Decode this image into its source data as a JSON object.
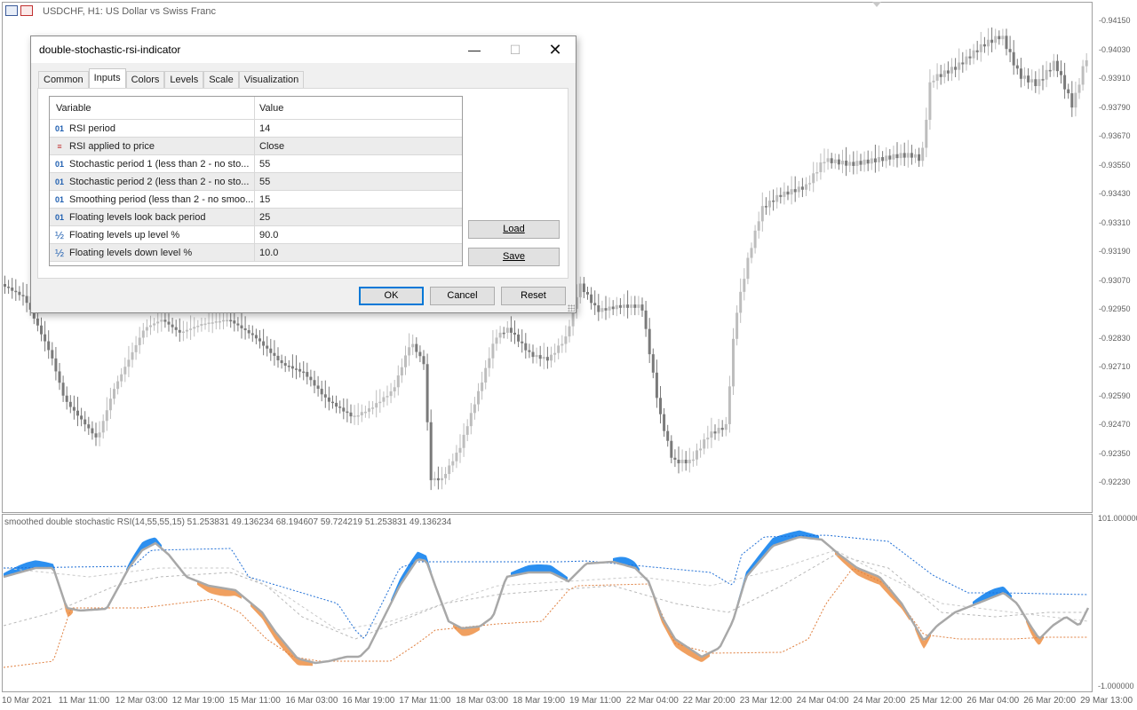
{
  "chart": {
    "title": "USDCHF, H1:  US Dollar vs Swiss Franc",
    "price_levels": [
      "0.94150",
      "0.94030",
      "0.93910",
      "0.93790",
      "0.93670",
      "0.93550",
      "0.93430",
      "0.93310",
      "0.93190",
      "0.93070",
      "0.92950",
      "0.92830",
      "0.92710",
      "0.92590",
      "0.92470",
      "0.92350",
      "0.92230"
    ],
    "time_labels": [
      "10 Mar 2021",
      "11 Mar 11:00",
      "12 Mar 03:00",
      "12 Mar 19:00",
      "15 Mar 11:00",
      "16 Mar 03:00",
      "16 Mar 19:00",
      "17 Mar 11:00",
      "18 Mar 03:00",
      "18 Mar 19:00",
      "19 Mar 11:00",
      "22 Mar 04:00",
      "22 Mar 20:00",
      "23 Mar 12:00",
      "24 Mar 04:00",
      "24 Mar 20:00",
      "25 Mar 12:00",
      "26 Mar 04:00",
      "26 Mar 20:00",
      "29 Mar 13:00"
    ],
    "colors": {
      "candle_bull": "#bdbdbd",
      "candle_bear": "#7a7a7a",
      "up_fill": "#2b8ff0",
      "down_fill": "#f0a060",
      "level_up": "#1f6fd6",
      "level_down": "#e08040",
      "main_line": "#a8a8a8"
    }
  },
  "indicator": {
    "title": "smoothed double stochastic RSI(14,55,55,15) 51.253831 49.136234 68.194607 59.724219 51.253831 49.136234",
    "scale_max": "101.000000",
    "scale_min": "-1.000000"
  },
  "dialog": {
    "title": "double-stochastic-rsi-indicator",
    "window_buttons": {
      "minimize": "—",
      "maximize": "☐",
      "close": "✕"
    },
    "tabs": [
      "Common",
      "Inputs",
      "Colors",
      "Levels",
      "Scale",
      "Visualization"
    ],
    "active_tab": "Inputs",
    "grid": {
      "headers": {
        "variable": "Variable",
        "value": "Value"
      },
      "rows": [
        {
          "icon": "01",
          "name": "RSI period",
          "value": "14"
        },
        {
          "icon": "≡",
          "name": "RSI applied to price",
          "value": "Close"
        },
        {
          "icon": "01",
          "name": "Stochastic period 1 (less than 2 - no sto...",
          "value": "55"
        },
        {
          "icon": "01",
          "name": "Stochastic period 2 (less than 2 - no sto...",
          "value": "55"
        },
        {
          "icon": "01",
          "name": "Smoothing period (less than 2 - no smoo...",
          "value": "15"
        },
        {
          "icon": "01",
          "name": "Floating levels look back period",
          "value": "25"
        },
        {
          "icon": "½",
          "name": "Floating levels up level %",
          "value": "90.0"
        },
        {
          "icon": "½",
          "name": "Floating levels down level %",
          "value": "10.0"
        }
      ]
    },
    "buttons": {
      "load": "Load",
      "save": "Save",
      "ok": "OK",
      "cancel": "Cancel",
      "reset": "Reset"
    }
  }
}
